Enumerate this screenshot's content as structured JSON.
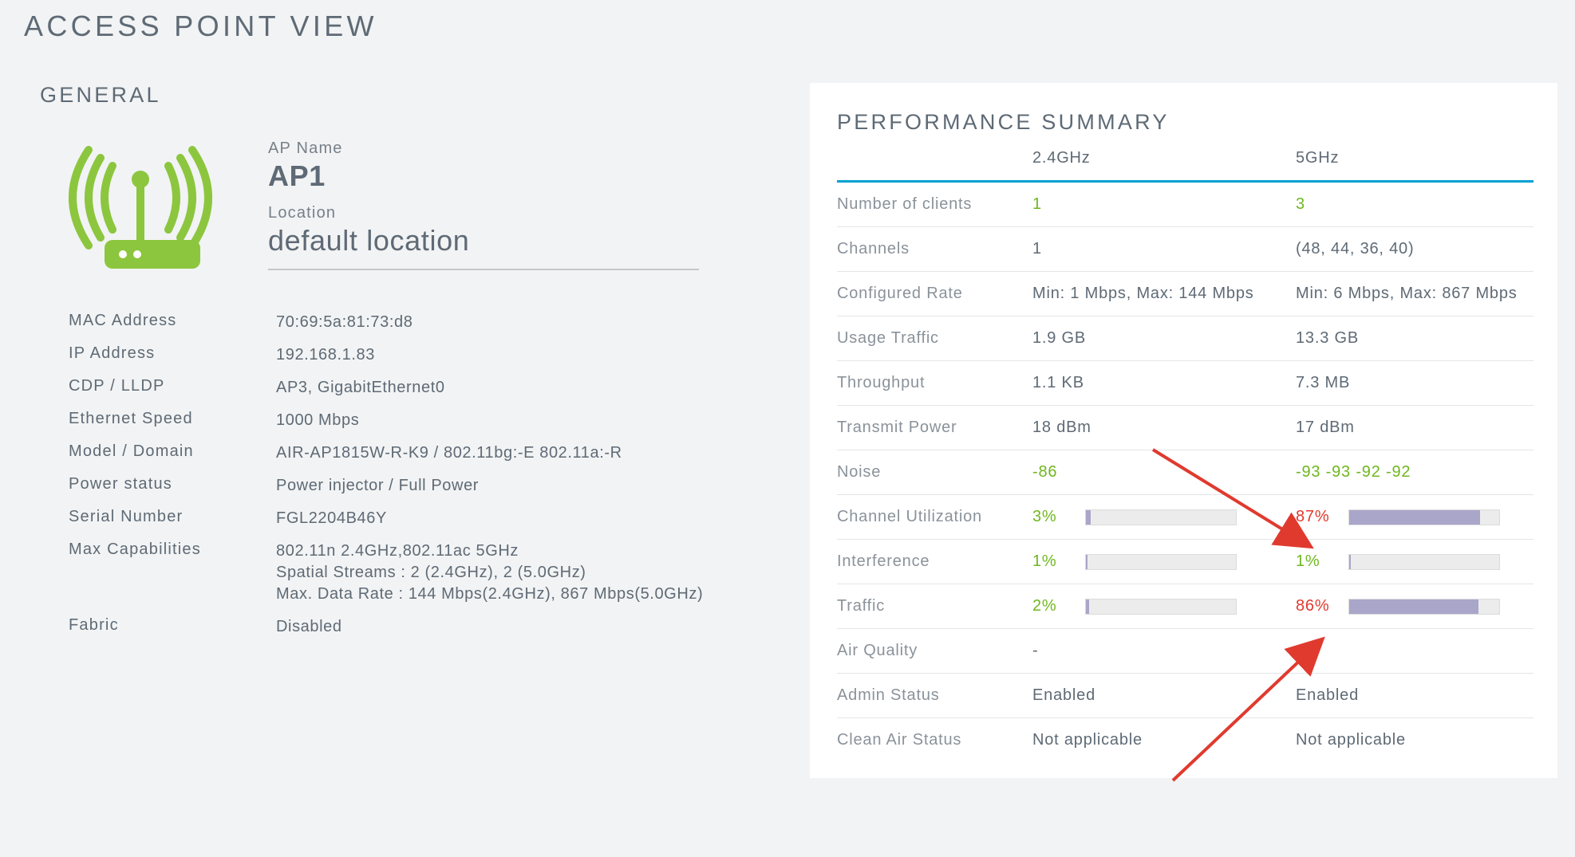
{
  "page": {
    "title": "ACCESS POINT VIEW"
  },
  "general": {
    "heading": "GENERAL",
    "ap_name_label": "AP Name",
    "ap_name": "AP1",
    "location_label": "Location",
    "location": "default location",
    "rows": [
      {
        "label": "MAC Address",
        "value": "70:69:5a:81:73:d8"
      },
      {
        "label": "IP Address",
        "value": "192.168.1.83"
      },
      {
        "label": "CDP / LLDP",
        "value": "AP3, GigabitEthernet0"
      },
      {
        "label": "Ethernet Speed",
        "value": "1000 Mbps"
      },
      {
        "label": "Model / Domain",
        "value": "AIR-AP1815W-R-K9 / 802.11bg:-E 802.11a:-R"
      },
      {
        "label": "Power status",
        "value": "Power injector / Full Power"
      },
      {
        "label": "Serial Number",
        "value": "FGL2204B46Y"
      },
      {
        "label": "Max Capabilities",
        "value": "802.11n 2.4GHz,802.11ac 5GHz\nSpatial Streams : 2 (2.4GHz), 2 (5.0GHz)\nMax. Data Rate : 144 Mbps(2.4GHz), 867 Mbps(5.0GHz)"
      },
      {
        "label": "Fabric",
        "value": "Disabled"
      }
    ]
  },
  "performance": {
    "heading": "PERFORMANCE SUMMARY",
    "columns": {
      "c1": "",
      "c2": "2.4GHz",
      "c3": "5GHz"
    },
    "rows": [
      {
        "metric": "Number of clients",
        "g24": {
          "text": "1",
          "cls": "green"
        },
        "g5": {
          "text": "3",
          "cls": "green"
        }
      },
      {
        "metric": "Channels",
        "g24": {
          "text": "1"
        },
        "g5": {
          "text": "(48, 44, 36, 40)"
        }
      },
      {
        "metric": "Configured Rate",
        "g24": {
          "text": "Min: 1 Mbps, Max: 144 Mbps"
        },
        "g5": {
          "text": "Min: 6 Mbps, Max: 867 Mbps"
        }
      },
      {
        "metric": "Usage Traffic",
        "g24": {
          "text": "1.9 GB"
        },
        "g5": {
          "text": "13.3 GB"
        }
      },
      {
        "metric": "Throughput",
        "g24": {
          "text": "1.1 KB"
        },
        "g5": {
          "text": "7.3 MB"
        }
      },
      {
        "metric": "Transmit Power",
        "g24": {
          "text": "18 dBm"
        },
        "g5": {
          "text": "17 dBm"
        }
      },
      {
        "metric": "Noise",
        "g24": {
          "text": "-86",
          "cls": "green"
        },
        "g5": {
          "text": "-93 -93 -92 -92",
          "cls": "green"
        }
      },
      {
        "metric": "Channel Utilization",
        "g24": {
          "pct": "3%",
          "cls": "green",
          "fill": 3
        },
        "g5": {
          "pct": "87%",
          "cls": "red",
          "fill": 87
        }
      },
      {
        "metric": "Interference",
        "g24": {
          "pct": "1%",
          "cls": "green",
          "fill": 1
        },
        "g5": {
          "pct": "1%",
          "cls": "green",
          "fill": 1
        }
      },
      {
        "metric": "Traffic",
        "g24": {
          "pct": "2%",
          "cls": "green",
          "fill": 2
        },
        "g5": {
          "pct": "86%",
          "cls": "red",
          "fill": 86
        }
      },
      {
        "metric": "Air Quality",
        "g24": {
          "text": "-"
        },
        "g5": {
          "text": "-"
        }
      },
      {
        "metric": "Admin Status",
        "g24": {
          "text": "Enabled"
        },
        "g5": {
          "text": "Enabled"
        }
      },
      {
        "metric": "Clean Air Status",
        "g24": {
          "text": "Not applicable"
        },
        "g5": {
          "text": "Not applicable"
        }
      }
    ]
  },
  "annotations": {
    "arrow1": {
      "note": "points at 87%"
    },
    "arrow2": {
      "note": "points at 86%"
    }
  },
  "colors": {
    "green": "#6fb71f",
    "red": "#e03a2f",
    "accent_blue": "#00a0d1",
    "bar_fill": "#a9a6c9"
  }
}
